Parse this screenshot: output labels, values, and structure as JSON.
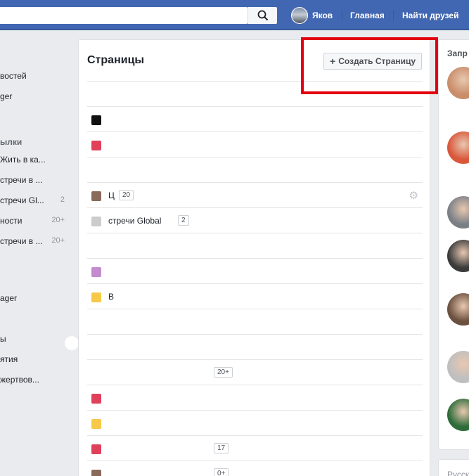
{
  "topbar": {
    "search_placeholder": "",
    "profile_name": "Яков",
    "home_label": "Главная",
    "find_friends_label": "Найти друзей"
  },
  "leftnav": {
    "items": [
      {
        "label": "востей",
        "count": ""
      },
      {
        "label": "ger",
        "count": ""
      },
      {
        "label": "ылки",
        "count": "",
        "heading": true
      },
      {
        "label": "Жить в ка...",
        "count": ""
      },
      {
        "label": "стречи в ...",
        "count": ""
      },
      {
        "label": "стречи Gl...",
        "count": "2"
      },
      {
        "label": "ности",
        "count": "20+"
      },
      {
        "label": "стречи в ...",
        "count": "20+"
      },
      {
        "label": "ager",
        "count": ""
      },
      {
        "label": "ы",
        "count": ""
      },
      {
        "label": "ятия",
        "count": ""
      },
      {
        "label": "жертвов...",
        "count": ""
      }
    ]
  },
  "main": {
    "title": "Страницы",
    "create_button": "Создать Страницу",
    "rows": [
      {
        "label": "",
        "count": "",
        "color": ""
      },
      {
        "label": "",
        "count": "",
        "color": "#111111"
      },
      {
        "label": "",
        "count": "",
        "color": "#e0405a"
      },
      {
        "label": "",
        "count": "",
        "color": ""
      },
      {
        "label": "Ц",
        "count": "20",
        "color": "#8a6a5a",
        "gear": true
      },
      {
        "label": "стречи Global",
        "count": "2",
        "color": "#cccccc"
      },
      {
        "label": "",
        "count": "",
        "color": ""
      },
      {
        "label": "",
        "count": "",
        "color": "#c48bd0"
      },
      {
        "label": "В",
        "count": "",
        "color": "#f7c948"
      },
      {
        "label": "",
        "count": "",
        "color": ""
      },
      {
        "label": "",
        "count": "",
        "color": ""
      },
      {
        "label": "",
        "count": "20+",
        "color": ""
      },
      {
        "label": "",
        "count": "",
        "color": "#e0405a"
      },
      {
        "label": "",
        "count": "",
        "color": "#f7c948"
      },
      {
        "label": "",
        "count": "17",
        "color": "#e0405a"
      },
      {
        "label": "",
        "count": "0+",
        "color": "#8a6a5a"
      }
    ]
  },
  "right": {
    "title": "Запр",
    "language_title": "Русск",
    "avatar_colors": [
      "#c98d6a",
      "#d9573b",
      "#7a7f86",
      "#3b3b3b",
      "#6b5040",
      "#bfbfbf",
      "#2e6b3a"
    ]
  },
  "colors": {
    "brand": "#4267b2",
    "highlight": "#e3000f"
  }
}
